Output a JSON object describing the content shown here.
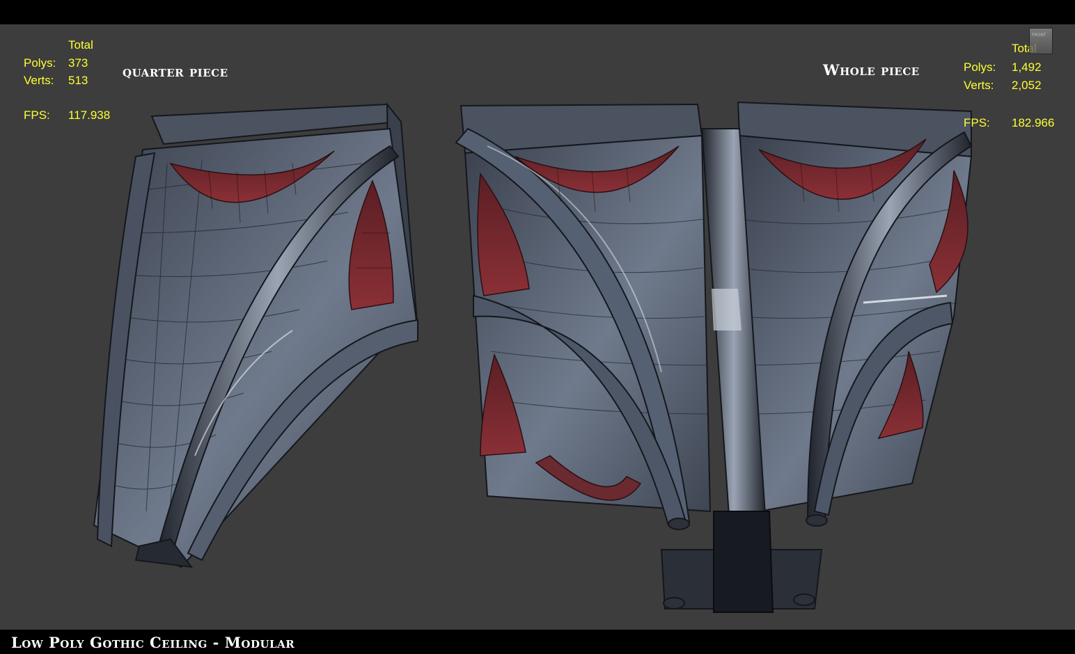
{
  "caption": "Low Poly Gothic Ceiling - Modular",
  "left_view": {
    "label": "quarter piece",
    "stats": {
      "header": "Total",
      "polys_label": "Polys:",
      "polys": "373",
      "verts_label": "Verts:",
      "verts": "513",
      "fps_label": "FPS:",
      "fps": "117.938"
    }
  },
  "right_view": {
    "label": "Whole piece",
    "stats": {
      "header": "Total",
      "polys_label": "Polys:",
      "polys": "1,492",
      "verts_label": "Verts:",
      "verts": "2,052",
      "fps_label": "FPS:",
      "fps": "182.966"
    }
  },
  "view_cube": {
    "label": "FRONT",
    "icon": "view-cube-icon"
  },
  "colors": {
    "viewport_bg": "#3d3d3d",
    "stats_text": "#ffff33",
    "mesh_dark": "#2d3340",
    "mesh_mid": "#4a5364",
    "mesh_light": "#8b96a8",
    "accent_red": "#7a2a2e"
  }
}
